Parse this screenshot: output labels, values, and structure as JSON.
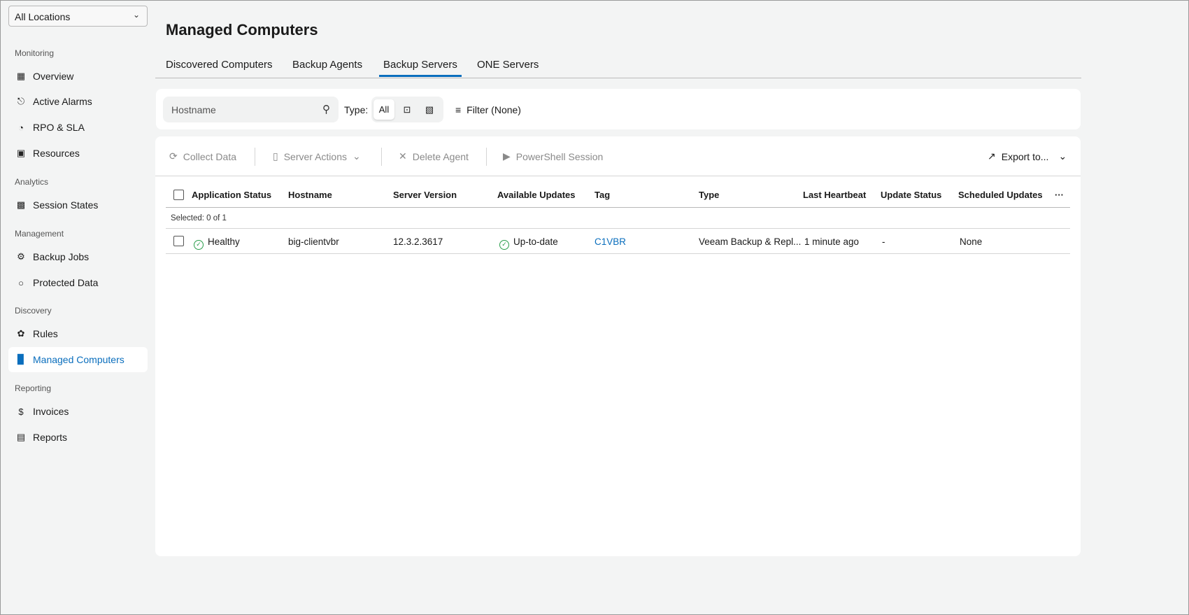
{
  "location": "All Locations",
  "sidebar": {
    "sections": [
      "Monitoring",
      "Analytics",
      "Management",
      "Discovery",
      "Reporting"
    ],
    "items": [
      {
        "label": "Overview",
        "icon": "dashboard-icon"
      },
      {
        "label": "Active Alarms",
        "icon": "bell-icon"
      },
      {
        "label": "RPO & SLA",
        "icon": "pie-chart-icon"
      },
      {
        "label": "Resources",
        "icon": "resources-icon"
      },
      {
        "label": "Session States",
        "icon": "grid-icon"
      },
      {
        "label": "Backup Jobs",
        "icon": "backup-jobs-icon"
      },
      {
        "label": "Protected Data",
        "icon": "lock-icon"
      },
      {
        "label": "Rules",
        "icon": "rules-icon"
      },
      {
        "label": "Managed Computers",
        "icon": "computer-icon"
      },
      {
        "label": "Invoices",
        "icon": "invoice-icon"
      },
      {
        "label": "Reports",
        "icon": "report-icon"
      }
    ]
  },
  "page_title": "Managed Computers",
  "tabs": [
    "Discovered Computers",
    "Backup Agents",
    "Backup Servers",
    "ONE Servers"
  ],
  "filters": {
    "search_placeholder": "Hostname",
    "type_label": "Type:",
    "type_all": "All",
    "filter_label": "Filter (None)"
  },
  "toolbar": {
    "collect": "Collect Data",
    "server_actions": "Server Actions",
    "delete": "Delete Agent",
    "powershell": "PowerShell Session",
    "export": "Export to..."
  },
  "table": {
    "columns": [
      "Application Status",
      "Hostname",
      "Server Version",
      "Available Updates",
      "Tag",
      "Type",
      "Last Heartbeat",
      "Update Status",
      "Scheduled Updates"
    ],
    "more": "···",
    "selected": "Selected: 0 of 1",
    "rows": [
      [
        "Healthy",
        "big-clientvbr",
        "12.3.2.3617",
        "Up-to-date",
        "C1VBR",
        "Veeam Backup & Repl...",
        "1 minute ago",
        "-",
        "None"
      ]
    ]
  },
  "colors": {
    "accent": "#0a6ebd",
    "healthy": "#2a9d4b"
  }
}
